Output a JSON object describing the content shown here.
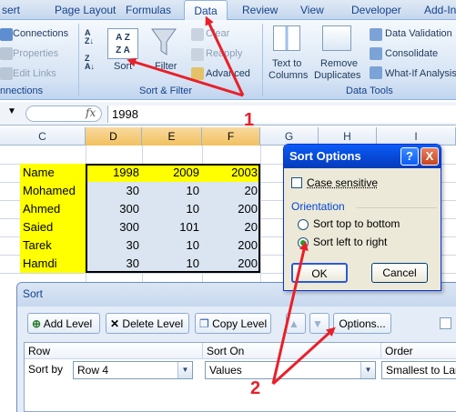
{
  "tabs": [
    "sert",
    "Page Layout",
    "Formulas",
    "Data",
    "Review",
    "View",
    "Developer",
    "Add-In"
  ],
  "active_tab": "Data",
  "ribbon": {
    "connections": {
      "connections_label": "Connections",
      "properties_label": "Properties",
      "edit_links_label": "Edit Links",
      "group_label": "nnections"
    },
    "sort_filter": {
      "az_glyph": "A↓Z",
      "za_glyph": "Z↓A",
      "sort_label": "Sort",
      "filter_label": "Filter",
      "clear_label": "Clear",
      "reapply_label": "Reapply",
      "advanced_label": "Advanced",
      "group_label": "Sort & Filter"
    },
    "data_tools": {
      "text_to_columns": [
        "Text to",
        "Columns"
      ],
      "remove_duplicates": [
        "Remove",
        "Duplicates"
      ],
      "data_validation": "Data Validation",
      "consolidate": "Consolidate",
      "what_if": "What-If Analysis",
      "group_label": "Data Tools"
    }
  },
  "formula_bar": {
    "fx": "fx",
    "value": "1998"
  },
  "grid": {
    "columns": [
      "C",
      "D",
      "E",
      "F",
      "G",
      "H",
      "I"
    ],
    "rows": [
      [
        "Name",
        "1998",
        "2009",
        "2003"
      ],
      [
        "Mohamed",
        "30",
        "10",
        "20"
      ],
      [
        "Ahmed",
        "300",
        "10",
        "200"
      ],
      [
        "Saied",
        "300",
        "101",
        "20"
      ],
      [
        "Tarek",
        "30",
        "10",
        "200"
      ],
      [
        "Hamdi",
        "30",
        "10",
        "200"
      ]
    ]
  },
  "annotations": {
    "callout_1": "1",
    "callout_2": "2",
    "arrow_color": "#e8202a"
  },
  "sort_options": {
    "title": "Sort Options",
    "help": "?",
    "close": "X",
    "case_sensitive_label": "Case sensitive",
    "case_sensitive": false,
    "orientation_label": "Orientation",
    "options": [
      "Sort top to bottom",
      "Sort left to right"
    ],
    "selected": "Sort left to right",
    "ok_label": "OK",
    "cancel_label": "Cancel"
  },
  "sort_dialog": {
    "title": "Sort",
    "add_level_label": "Add Level",
    "delete_level_label": "Delete Level",
    "copy_level_label": "Copy Level",
    "options_label": "Options...",
    "headers": [
      "Row",
      "Sort On",
      "Order"
    ],
    "row_label": "Sort by",
    "row_value": "Row 4",
    "sort_on_value": "Values",
    "order_value": "Smallest to Largest"
  }
}
